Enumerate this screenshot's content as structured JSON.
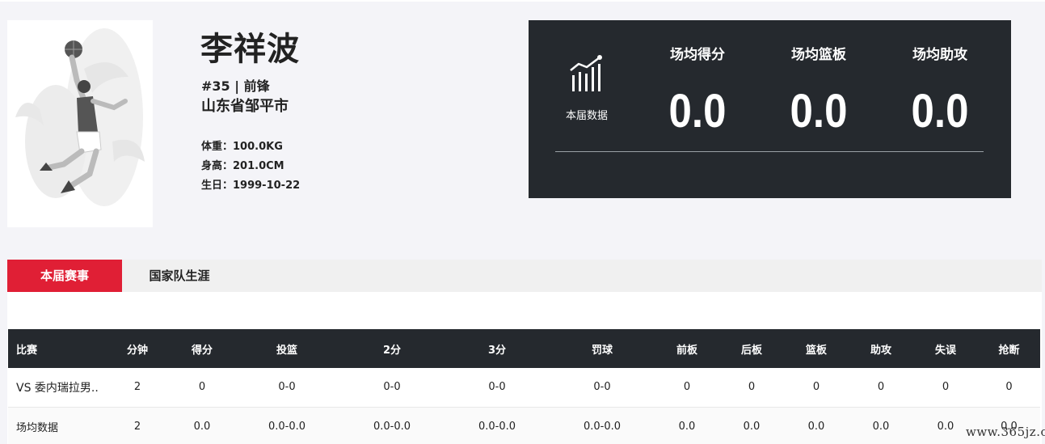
{
  "player": {
    "name": "李祥波",
    "number_position": "#35 | 前锋",
    "hometown": "山东省邹平市",
    "weight": "体重：100.0KG",
    "height": "身高：201.0CM",
    "birthday": "生日：1999-10-22"
  },
  "season_stats": {
    "label": "本届数据",
    "icon": "bar-chart-trend-icon",
    "items": [
      {
        "label": "场均得分",
        "value": "0.0"
      },
      {
        "label": "场均篮板",
        "value": "0.0"
      },
      {
        "label": "场均助攻",
        "value": "0.0"
      }
    ]
  },
  "tabs": [
    {
      "label": "本届赛事",
      "active": true
    },
    {
      "label": "国家队生涯",
      "active": false
    }
  ],
  "table": {
    "headers": [
      "比赛",
      "分钟",
      "得分",
      "投篮",
      "2分",
      "3分",
      "罚球",
      "前板",
      "后板",
      "篮板",
      "助攻",
      "失误",
      "抢断"
    ],
    "rows": [
      [
        "VS 委内瑞拉男..",
        "2",
        "0",
        "0-0",
        "0-0",
        "0-0",
        "0-0",
        "0",
        "0",
        "0",
        "0",
        "0",
        "0"
      ],
      [
        "场均数据",
        "2",
        "0.0",
        "0.0-0.0",
        "0.0-0.0",
        "0.0-0.0",
        "0.0-0.0",
        "0.0",
        "0.0",
        "0.0",
        "0.0",
        "0.0",
        "0.0"
      ]
    ]
  },
  "watermark": "www.365jz.com",
  "colors": {
    "accent": "#e01f35",
    "panel_bg": "#25292e",
    "page_bg": "#f4f4f8"
  }
}
